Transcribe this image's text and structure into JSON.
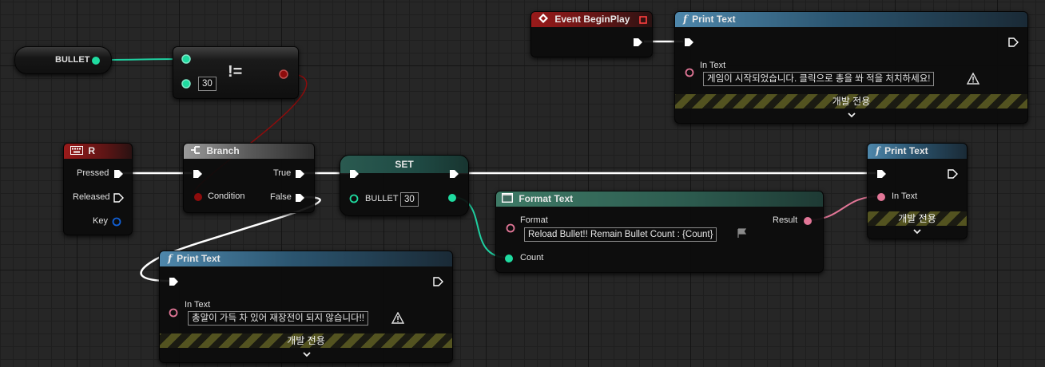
{
  "colors": {
    "exec": "#ffffff",
    "int_pin": "#1fdba0",
    "bool_pin": "#8e0c0c",
    "string_pin": "#f07ba4",
    "text_pin": "#e27697",
    "struct_pin": "#1160d6",
    "event_header": "#9a1a1a",
    "function_header": "#4e87ab"
  },
  "nodes": {
    "bullet_getter": {
      "var_name": "BULLET"
    },
    "not_equal": {
      "operator_symbol": "!=",
      "value": "30"
    },
    "event_begin_play": {
      "title": "Event BeginPlay"
    },
    "print_text_top": {
      "title": "Print Text",
      "in_text_label": "In Text",
      "in_text_value": "게임이 시작되었습니다. 클릭으로 총을 쏴 적을 처치하세요!",
      "dev_only_label": "개발 전용"
    },
    "key_r": {
      "title": "R",
      "pressed_label": "Pressed",
      "released_label": "Released",
      "key_label": "Key"
    },
    "branch": {
      "title": "Branch",
      "condition_label": "Condition",
      "true_label": "True",
      "false_label": "False"
    },
    "set_bullet": {
      "title": "SET",
      "var_name": "BULLET",
      "value": "30"
    },
    "format_text": {
      "title": "Format Text",
      "format_label": "Format",
      "format_value": "Reload Bullet!! Remain Bullet Count : {Count}",
      "result_label": "Result",
      "count_label": "Count"
    },
    "print_text_right": {
      "title": "Print Text",
      "in_text_label": "In Text",
      "dev_only_label": "개발 전용"
    },
    "print_text_bottom": {
      "title": "Print Text",
      "in_text_label": "In Text",
      "in_text_value": "총알이 가득 차 있어 재장전이 되지 않습니다!!",
      "dev_only_label": "개발 전용"
    }
  }
}
